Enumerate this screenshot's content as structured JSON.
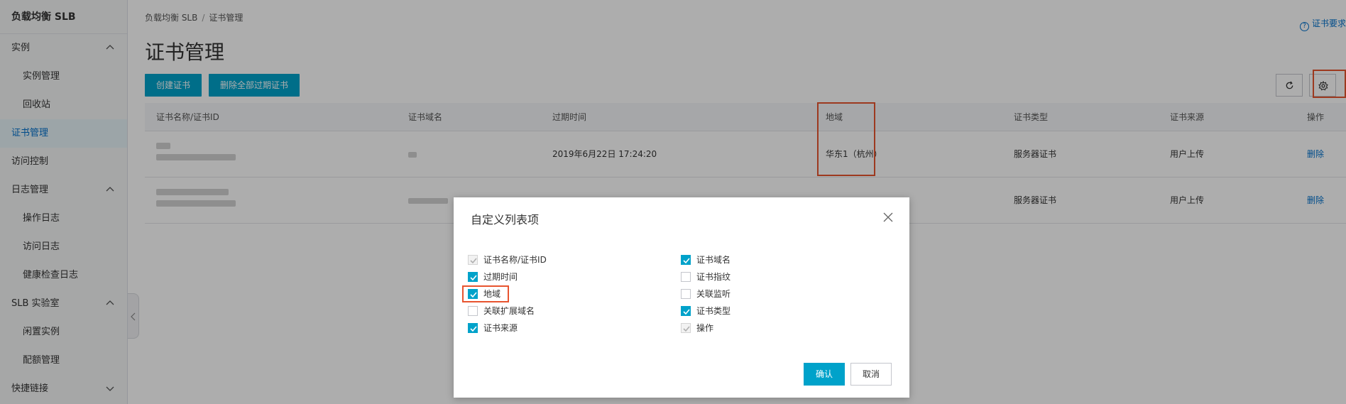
{
  "sidebar": {
    "title": "负载均衡 SLB",
    "items": [
      {
        "label": "实例"
      },
      {
        "label": "实例管理"
      },
      {
        "label": "回收站"
      },
      {
        "label": "证书管理"
      },
      {
        "label": "访问控制"
      },
      {
        "label": "日志管理"
      },
      {
        "label": "操作日志"
      },
      {
        "label": "访问日志"
      },
      {
        "label": "健康检查日志"
      },
      {
        "label": "SLB 实验室"
      },
      {
        "label": "闲置实例"
      },
      {
        "label": "配额管理"
      },
      {
        "label": "快捷链接"
      }
    ]
  },
  "breadcrumb": {
    "root": "负载均衡 SLB",
    "separator": "/",
    "current": "证书管理"
  },
  "help_link": "证书要求",
  "page_title": "证书管理",
  "toolbar": {
    "create": "创建证书",
    "delete_expired": "删除全部过期证书"
  },
  "table": {
    "headers": [
      "证书名称/证书ID",
      "证书域名",
      "过期时间",
      "地域",
      "证书类型",
      "证书来源",
      "操作"
    ],
    "rows": [
      {
        "expire": "2019年6月22日 17:24:20",
        "region": "华东1（杭州）",
        "type": "服务器证书",
        "source": "用户上传",
        "action": "删除"
      },
      {
        "expire": "",
        "region": "",
        "type": "服务器证书",
        "source": "用户上传",
        "action": "删除"
      }
    ]
  },
  "dialog": {
    "title": "自定义列表项",
    "options_left": [
      {
        "label": "证书名称/证书ID",
        "state": "disabled-checked"
      },
      {
        "label": "过期时间",
        "state": "checked"
      },
      {
        "label": "地域",
        "state": "checked"
      },
      {
        "label": "关联扩展域名",
        "state": "unchecked"
      },
      {
        "label": "证书来源",
        "state": "checked"
      }
    ],
    "options_right": [
      {
        "label": "证书域名",
        "state": "checked"
      },
      {
        "label": "证书指纹",
        "state": "unchecked"
      },
      {
        "label": "关联监听",
        "state": "unchecked"
      },
      {
        "label": "证书类型",
        "state": "checked"
      },
      {
        "label": "操作",
        "state": "disabled-checked"
      }
    ],
    "ok": "确认",
    "cancel": "取消"
  },
  "colors": {
    "primary": "#00a2ca",
    "link": "#0070cc",
    "highlight": "#e8542f"
  },
  "icons": [
    "chevron-up-icon",
    "chevron-down-icon",
    "collapse-left-icon",
    "refresh-icon",
    "gear-icon",
    "help-icon",
    "close-icon",
    "check-icon"
  ]
}
